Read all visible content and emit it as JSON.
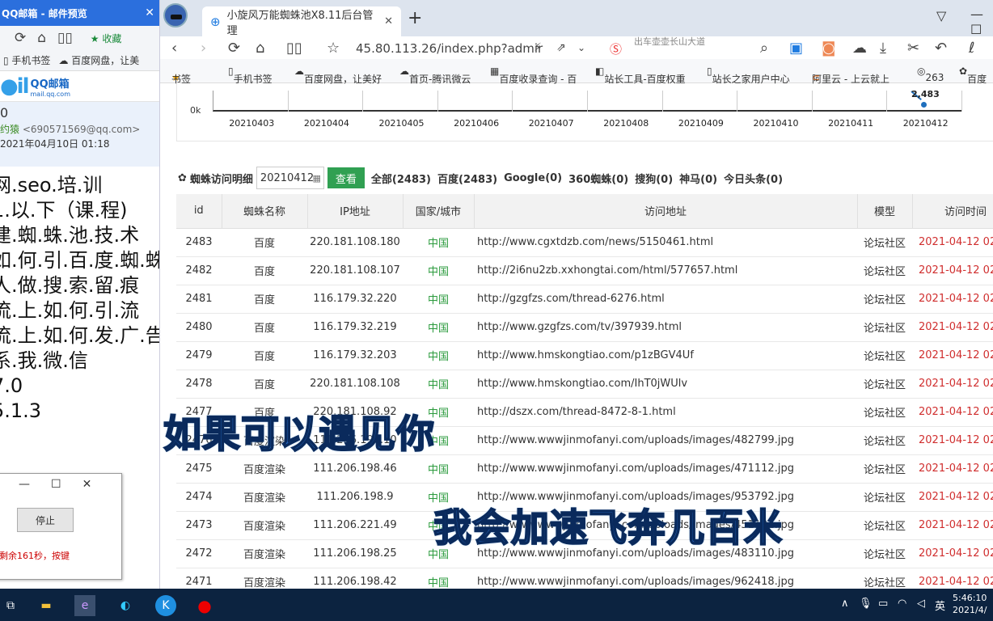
{
  "left_window": {
    "title": "QQ邮箱 - 邮件预览",
    "favorites_label": "★ 收藏",
    "bookmarks": [
      "手机书签",
      "百度网盘，让美"
    ],
    "logo_text": "QQ邮箱",
    "logo_sub": "mail.qq.com",
    "subject_fragment": "0",
    "sender_name": "约猿",
    "sender_email": "<690571569@qq.com>",
    "date": "2021年04月10日 01:18",
    "body_lines": [
      "网.seo.培.训",
      "1.以.下（课.程)",
      "建.蜘.蛛.池.技.术",
      "如.何.引.百.度.蜘.蛛)",
      "人.做.搜.索.留.痕",
      "流.上.如.何.引.流",
      "流.上.如.何.发.广.告",
      "系.我.微.信",
      "7.0",
      "5.1.3"
    ]
  },
  "dialog": {
    "stop_label": "停止",
    "countdown": "剩余161秒，按键"
  },
  "browser": {
    "tab_title": "小旋风万能蜘蛛池X8.11后台管理",
    "url": "45.80.113.26/index.php?admir",
    "search_hint": "出车壶壶长山大道",
    "bookmarks": [
      "书签",
      "手机书签",
      "百度网盘，让美好",
      "首页-腾讯微云",
      "百度收录查询 - 百",
      "站长工具-百度权重",
      "站长之家用户中心",
      "阿里云 - 上云就上",
      "263",
      "百度"
    ]
  },
  "chart_data": {
    "type": "line",
    "categories": [
      "20210403",
      "20210404",
      "20210405",
      "20210406",
      "20210407",
      "20210408",
      "20210409",
      "20210410",
      "20210411",
      "20210412"
    ],
    "y_tick": "0k",
    "data_label": "2,483",
    "values": [
      0,
      0,
      0,
      0,
      0,
      0,
      0,
      0,
      0,
      2483
    ]
  },
  "filter": {
    "label": "蜘蛛访问明细",
    "date_value": "20210412",
    "query_label": "查看",
    "categories": [
      "全部(2483)",
      "百度(2483)",
      "Google(0)",
      "360蜘蛛(0)",
      "搜狗(0)",
      "神马(0)",
      "今日头条(0)"
    ]
  },
  "table": {
    "headers": [
      "id",
      "蜘蛛名称",
      "IP地址",
      "国家/城市",
      "访问地址",
      "模型",
      "访问时间"
    ],
    "rows": [
      [
        "2483",
        "百度",
        "220.181.108.180",
        "中国",
        "http://www.cgxtdzb.com/news/5150461.html",
        "论坛社区",
        "2021-04-12 02"
      ],
      [
        "2482",
        "百度",
        "220.181.108.107",
        "中国",
        "http://2i6nu2zb.xxhongtai.com/html/577657.html",
        "论坛社区",
        "2021-04-12 02"
      ],
      [
        "2481",
        "百度",
        "116.179.32.220",
        "中国",
        "http://gzgfzs.com/thread-6276.html",
        "论坛社区",
        "2021-04-12 02"
      ],
      [
        "2480",
        "百度",
        "116.179.32.219",
        "中国",
        "http://www.gzgfzs.com/tv/397939.html",
        "论坛社区",
        "2021-04-12 02"
      ],
      [
        "2479",
        "百度",
        "116.179.32.203",
        "中国",
        "http://www.hmskongtiao.com/p1zBGV4Uf",
        "论坛社区",
        "2021-04-12 02"
      ],
      [
        "2478",
        "百度",
        "220.181.108.108",
        "中国",
        "http://www.hmskongtiao.com/IhT0jWUlv",
        "论坛社区",
        "2021-04-12 02"
      ],
      [
        "2477",
        "百度",
        "220.181.108.92",
        "中国",
        "http://dszx.com/thread-8472-8-1.html",
        "论坛社区",
        "2021-04-12 02"
      ],
      [
        "2476",
        "百度渲染",
        "111.206.198.10",
        "中国",
        "http://www.wwwjinmofanyi.com/uploads/images/482799.jpg",
        "论坛社区",
        "2021-04-12 02"
      ],
      [
        "2475",
        "百度渲染",
        "111.206.198.46",
        "中国",
        "http://www.wwwjinmofanyi.com/uploads/images/471112.jpg",
        "论坛社区",
        "2021-04-12 02"
      ],
      [
        "2474",
        "百度渲染",
        "111.206.198.9",
        "中国",
        "http://www.wwwjinmofanyi.com/uploads/images/953792.jpg",
        "论坛社区",
        "2021-04-12 02"
      ],
      [
        "2473",
        "百度渲染",
        "111.206.221.49",
        "中国",
        "http://www.wwwjinmofanyi.com/uploads/images/451131.jpg",
        "论坛社区",
        "2021-04-12 02"
      ],
      [
        "2472",
        "百度渲染",
        "111.206.198.25",
        "中国",
        "http://www.wwwjinmofanyi.com/uploads/images/483110.jpg",
        "论坛社区",
        "2021-04-12 02"
      ],
      [
        "2471",
        "百度渲染",
        "111.206.198.42",
        "中国",
        "http://www.wwwjinmofanyi.com/uploads/images/962418.jpg",
        "论坛社区",
        "2021-04-12 02"
      ]
    ]
  },
  "captions": [
    "如果可以遇见你",
    "我会加速飞奔几百米"
  ],
  "taskbar": {
    "ime": "英",
    "time": "5:46:10",
    "date": "2021/4/"
  },
  "colors": {
    "accent": "#2b6fdd",
    "green": "#30a052",
    "red_time": "#d02e2e",
    "taskbar": "#0c2340"
  }
}
